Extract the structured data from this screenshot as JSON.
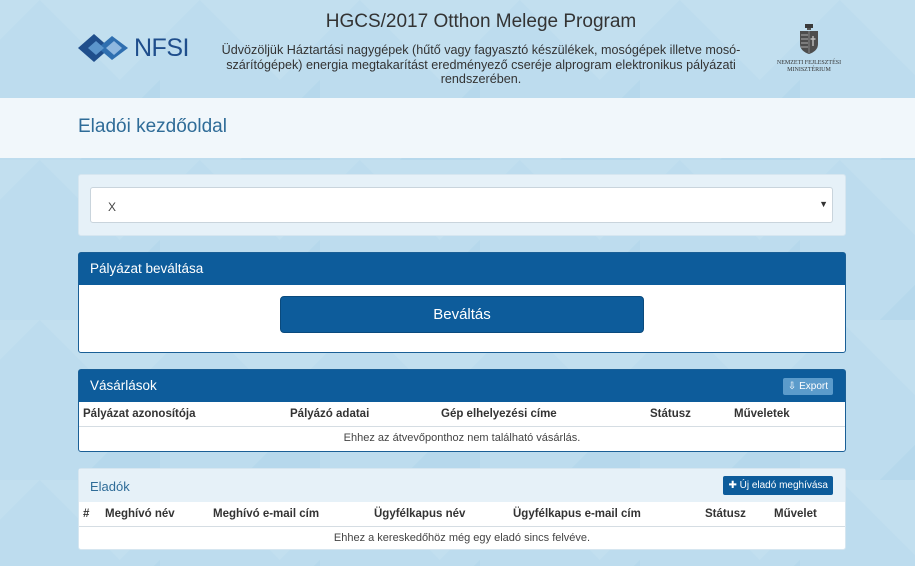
{
  "header": {
    "logo_text": "NFSI",
    "title": "HGCS/2017 Otthon Melege Program",
    "subtitle": "Üdvözöljük Háztartási nagygépek (hűtő vagy fagyasztó készülékek, mosógépek illetve mosó-szárítógépek) energia megtakarítást eredményező cseréje alprogram elektronikus pályázati rendszerében.",
    "ministry_name": "Nemzeti Fejlesztési Minisztérium"
  },
  "page": {
    "title": "Eladói kezdőoldal"
  },
  "select": {
    "value": "X"
  },
  "redeem": {
    "heading": "Pályázat beváltása",
    "button_label": "Beváltás"
  },
  "purchases": {
    "heading": "Vásárlások",
    "export_label": "Export",
    "columns": [
      "Pályázat azonosítója",
      "Pályázó adatai",
      "Gép elhelyezési címe",
      "Státusz",
      "Műveletek"
    ],
    "empty_text": "Ehhez az átvevőponthoz nem található vásárlás."
  },
  "sellers": {
    "heading": "Eladók",
    "invite_label": "Új eladó meghívása",
    "columns": [
      "#",
      "Meghívó név",
      "Meghívó e-mail cím",
      "Ügyfélkapus név",
      "Ügyfélkapus e-mail cím",
      "Státusz",
      "Művelet"
    ],
    "empty_text": "Ehhez a kereskedőhöz még egy eladó sincs felvéve."
  },
  "colors": {
    "primary": "#0d5c9b",
    "background": "#bddcee",
    "title_text": "#2f6c98"
  }
}
